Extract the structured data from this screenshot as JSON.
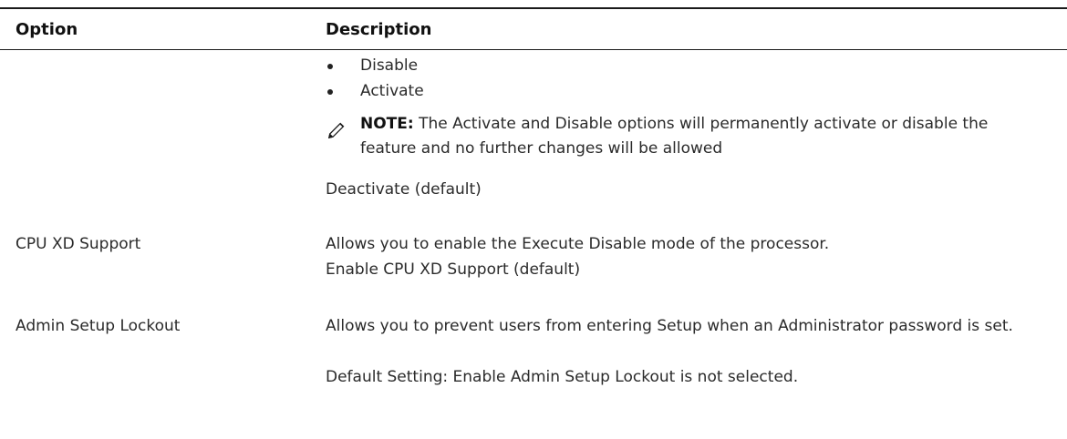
{
  "table": {
    "headers": {
      "option": "Option",
      "description": "Description"
    },
    "rows": [
      {
        "option": "",
        "bullets": [
          "Disable",
          "Activate"
        ],
        "note": {
          "label": "NOTE:",
          "text": "The Activate and Disable options will permanently activate or disable the feature and no further changes will be allowed"
        },
        "default": "Deactivate (default)"
      },
      {
        "option": "CPU XD Support",
        "description": "Allows you to enable the Execute Disable mode of the processor.",
        "default": "Enable CPU XD Support (default)"
      },
      {
        "option": "Admin Setup Lockout",
        "description": "Allows you to prevent users from entering Setup when an Administrator password is set.",
        "default": "Default Setting: Enable Admin Setup Lockout is not selected."
      }
    ]
  },
  "icons": {
    "note": "pencil-icon"
  }
}
